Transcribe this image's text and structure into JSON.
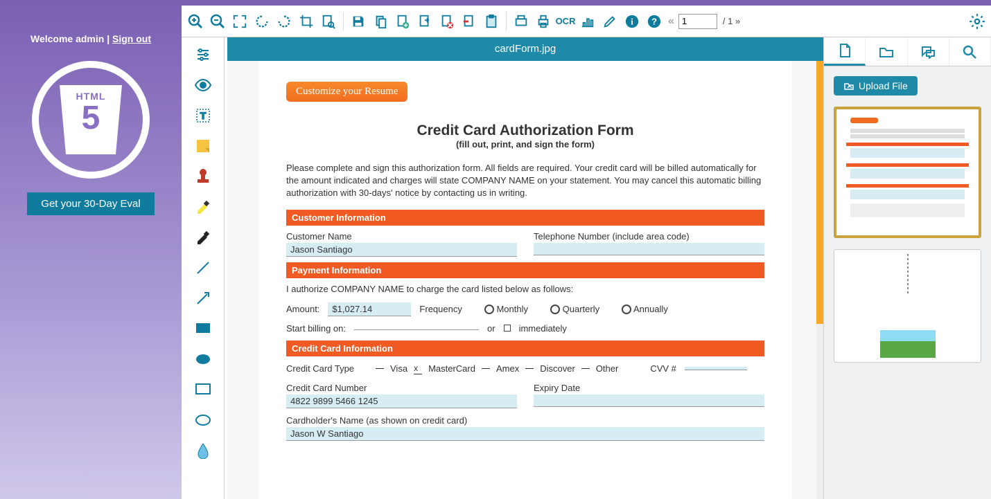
{
  "left": {
    "welcome_prefix": "Welcome admin | ",
    "signout": "Sign out",
    "logo_top": "HTML",
    "logo_num": "5",
    "eval": "Get your 30-Day Eval"
  },
  "toolbar": {
    "page_input": "1",
    "page_total": "/ 1",
    "ocr": "OCR"
  },
  "doc": {
    "filename": "cardForm.jpg",
    "customize": "Customize your Resume",
    "title": "Credit Card Authorization Form",
    "subtitle": "(fill out, print, and sign the form)",
    "instr": "Please complete and sign this authorization form. All fields are required. Your credit card will be billed automatically for the amount indicated and charges will state COMPANY NAME on your statement. You may cancel this automatic billing authorization with 30-days' notice by contacting us in writing.",
    "sect1": "Customer Information",
    "cust_name_lbl": "Customer Name",
    "cust_name_val": "Jason Santiago",
    "tel_lbl": "Telephone Number (include area code)",
    "sect2": "Payment Information",
    "auth": "I authorize COMPANY NAME to charge the card listed below as follows:",
    "amount_lbl": "Amount:",
    "amount_val": "$1,027.14",
    "freq_lbl": "Frequency",
    "freq_monthly": "Monthly",
    "freq_quarterly": "Quarterly",
    "freq_annually": "Annually",
    "start_lbl": "Start billing on:",
    "or": "or",
    "immediately": "immediately",
    "sect3": "Credit Card Information",
    "cctype_lbl": "Credit Card Type",
    "visa": "Visa",
    "mc": "MasterCard",
    "amex": "Amex",
    "discover": "Discover",
    "other": "Other",
    "cvv": "CVV #",
    "ccnum_lbl": "Credit Card Number",
    "ccnum_val": "4822 9899 5466 1245",
    "expiry_lbl": "Expiry Date",
    "holder_lbl": "Cardholder's Name (as shown on credit card)",
    "holder_val": "Jason W Santiago"
  },
  "right": {
    "upload": "Upload File"
  }
}
